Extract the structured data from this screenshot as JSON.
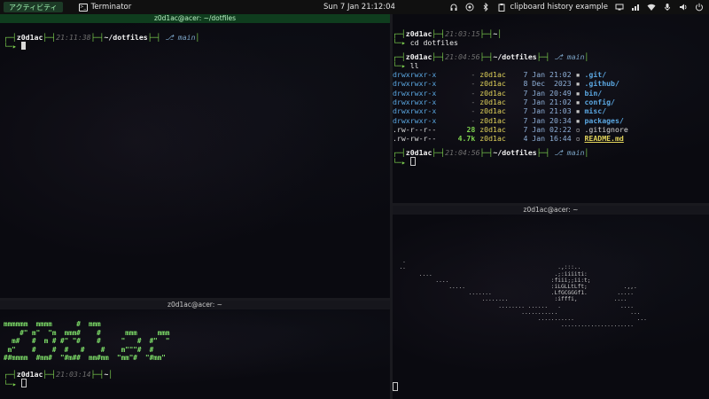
{
  "topbar": {
    "activities_label": "アクティビティ",
    "app_name": "Terminator",
    "clock": "Sun 7 Jan  21:12:04",
    "clipboard_label": "clipboard history example"
  },
  "panes": {
    "top_left": {
      "title": "z0d1ac@acer: ~/dotfiles",
      "prompt": {
        "user": "z0d1ac",
        "time": "21:11:38",
        "dir": "~/dotfiles",
        "git_branch": "⎇ main"
      }
    },
    "top_right": {
      "prompt1": {
        "user": "z0d1ac",
        "time": "21:03:15",
        "dir": "~"
      },
      "command1": "cd dotfiles",
      "prompt2": {
        "user": "z0d1ac",
        "time": "21:04:56",
        "dir": "~/dotfiles",
        "git_branch": "⎇ main"
      },
      "command2": "ll",
      "listing": [
        {
          "perms": "drwxrwxr-x",
          "size": "-",
          "owner": "z0d1ac",
          "date": "7 Jan 21:02",
          "icon": "",
          "name": ".git/",
          "kind": "dir"
        },
        {
          "perms": "drwxrwxr-x",
          "size": "-",
          "owner": "z0d1ac",
          "date": "8 Dec  2023",
          "icon": "",
          "name": ".github/",
          "kind": "dir"
        },
        {
          "perms": "drwxrwxr-x",
          "size": "-",
          "owner": "z0d1ac",
          "date": "7 Jan 20:49",
          "icon": "",
          "name": "bin/",
          "kind": "dir"
        },
        {
          "perms": "drwxrwxr-x",
          "size": "-",
          "owner": "z0d1ac",
          "date": "7 Jan 21:02",
          "icon": "",
          "name": "config/",
          "kind": "dir"
        },
        {
          "perms": "drwxrwxr-x",
          "size": "-",
          "owner": "z0d1ac",
          "date": "7 Jan 21:03",
          "icon": "",
          "name": "misc/",
          "kind": "dir"
        },
        {
          "perms": "drwxrwxr-x",
          "size": "-",
          "owner": "z0d1ac",
          "date": "7 Jan 20:34",
          "icon": "",
          "name": "packages/",
          "kind": "dir"
        },
        {
          "perms": ".rw-r--r--",
          "size": "28",
          "owner": "z0d1ac",
          "date": "7 Jan 02:22",
          "icon": "",
          "name": ".gitignore",
          "kind": "file"
        },
        {
          "perms": ".rw-rw-r--",
          "size": "4.7k",
          "owner": "z0d1ac",
          "date": "4 Jan 16:44",
          "icon": "",
          "name": "README.md",
          "kind": "readme"
        }
      ],
      "prompt3": {
        "user": "z0d1ac",
        "time": "21:04:56",
        "dir": "~/dotfiles",
        "git_branch": "⎇ main"
      }
    },
    "bottom_left": {
      "title": "z0d1ac@acer: ~",
      "figlet_lines": [
        "mmmmmm  mmmm      #  mmm",
        "    #\" m\"  \"m  mmm#    #      mmm     mmm",
        "  m#   #  m # #\" \"#    #     \"   #  #\"  \"",
        " m\"    #    #  #   #    #    m\"\"\"#  #",
        "##mmmm  #mm#  \"#m##  mm#mm  \"mm\"#  \"#mm\""
      ],
      "prompt": {
        "user": "z0d1ac",
        "time": "21:03:14",
        "dir": "~"
      }
    },
    "bottom_right": {
      "title": "z0d1ac@acer: ~"
    }
  }
}
